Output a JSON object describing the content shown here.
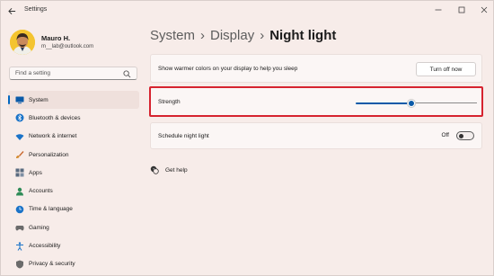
{
  "window": {
    "title": "Settings",
    "back_icon": "arrow-left-icon",
    "controls": [
      "minimize-icon",
      "maximize-icon",
      "close-icon"
    ]
  },
  "profile": {
    "name": "Mauro H.",
    "email": "m__lab@outlook.com"
  },
  "search": {
    "placeholder": "Find a setting",
    "icon": "search-icon"
  },
  "sidebar": {
    "items": [
      {
        "label": "System",
        "icon": "monitor-icon",
        "active": true
      },
      {
        "label": "Bluetooth & devices",
        "icon": "bluetooth-icon"
      },
      {
        "label": "Network & internet",
        "icon": "wifi-icon"
      },
      {
        "label": "Personalization",
        "icon": "brush-icon"
      },
      {
        "label": "Apps",
        "icon": "apps-icon"
      },
      {
        "label": "Accounts",
        "icon": "person-icon"
      },
      {
        "label": "Time & language",
        "icon": "globe-clock-icon"
      },
      {
        "label": "Gaming",
        "icon": "gamepad-icon"
      },
      {
        "label": "Accessibility",
        "icon": "accessibility-icon"
      },
      {
        "label": "Privacy & security",
        "icon": "shield-icon"
      }
    ]
  },
  "breadcrumb": {
    "parts": [
      "System",
      "Display"
    ],
    "current": "Night light",
    "separator": "›"
  },
  "settings": {
    "warm_colors": {
      "label": "Show warmer colors on your display to help you sleep",
      "button": "Turn off now"
    },
    "strength": {
      "label": "Strength",
      "value_fraction": 0.46
    },
    "schedule": {
      "label": "Schedule night light",
      "state": "Off"
    }
  },
  "help": {
    "label": "Get help",
    "icon": "help-chat-icon"
  },
  "colors": {
    "accent": "#0a5aa8",
    "highlight_border": "#d6232f",
    "window_bg": "#f7ece9"
  }
}
